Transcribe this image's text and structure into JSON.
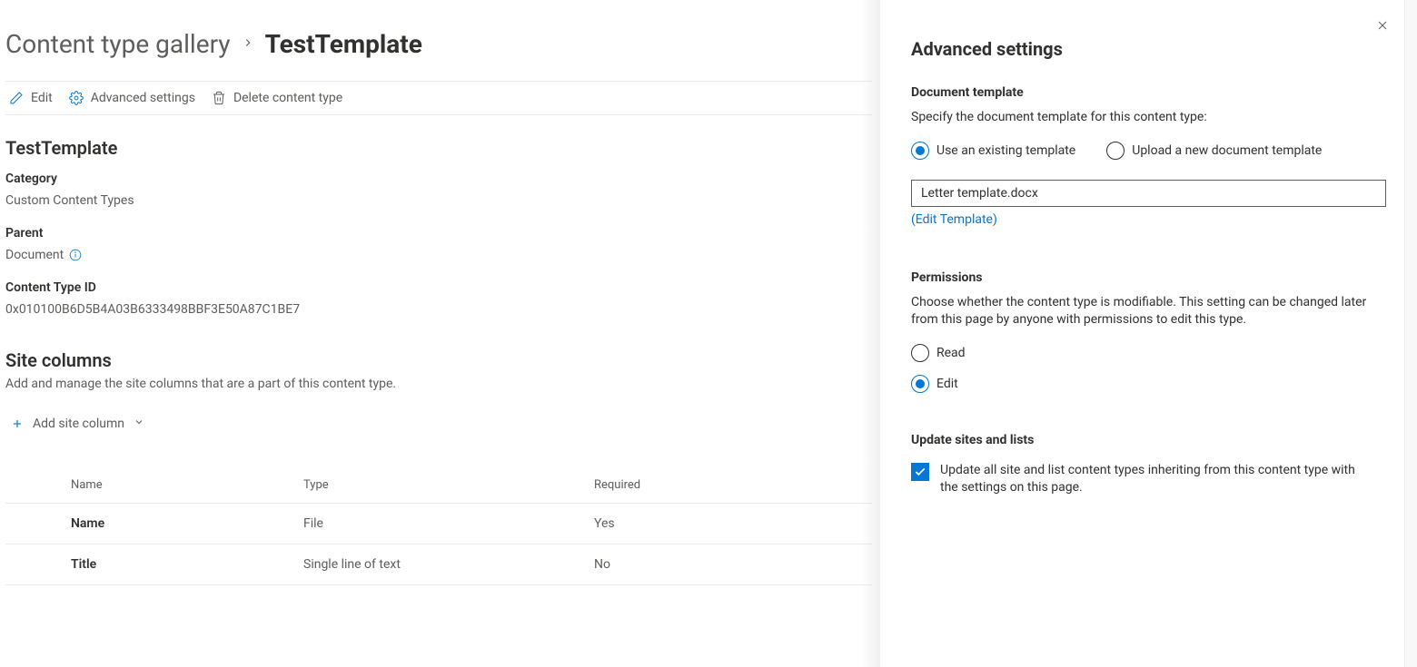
{
  "breadcrumb": {
    "parent": "Content type gallery",
    "current": "TestTemplate"
  },
  "commands": {
    "edit": "Edit",
    "advanced": "Advanced settings",
    "delete": "Delete content type"
  },
  "details": {
    "title": "TestTemplate",
    "category_label": "Category",
    "category_value": "Custom Content Types",
    "parent_label": "Parent",
    "parent_value": "Document",
    "ctid_label": "Content Type ID",
    "ctid_value": "0x010100B6D5B4A03B6333498BBF3E50A87C1BE7"
  },
  "site_columns": {
    "title": "Site columns",
    "description": "Add and manage the site columns that are a part of this content type.",
    "add_label": "Add site column",
    "headers": {
      "name": "Name",
      "type": "Type",
      "required": "Required"
    },
    "rows": [
      {
        "name": "Name",
        "type": "File",
        "required": "Yes"
      },
      {
        "name": "Title",
        "type": "Single line of text",
        "required": "No"
      }
    ]
  },
  "panel": {
    "title": "Advanced settings",
    "doc_template": {
      "heading": "Document template",
      "description": "Specify the document template for this content type:",
      "option_existing": "Use an existing template",
      "option_upload": "Upload a new document template",
      "input_value": "Letter template.docx",
      "edit_link": "(Edit Template)"
    },
    "permissions": {
      "heading": "Permissions",
      "description": "Choose whether the content type is modifiable. This setting can be changed later from this page by anyone with permissions to edit this type.",
      "option_read": "Read",
      "option_edit": "Edit"
    },
    "update": {
      "heading": "Update sites and lists",
      "checkbox_label": "Update all site and list content types inheriting from this content type with the settings on this page."
    }
  }
}
